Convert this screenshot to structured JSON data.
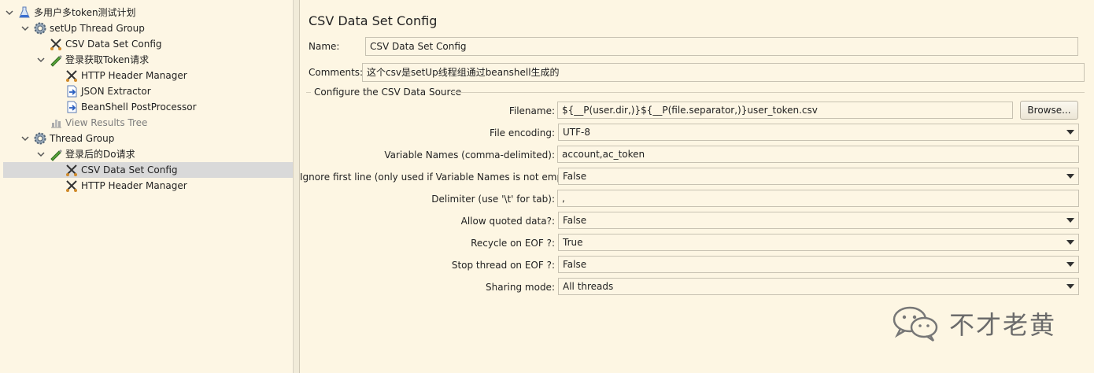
{
  "tree": {
    "items": [
      {
        "label": "多用户多token测试计划",
        "icon": "flask-icon",
        "expanded": true
      },
      {
        "label": "setUp Thread Group",
        "icon": "gear-icon",
        "expanded": true
      },
      {
        "label": "CSV Data Set Config",
        "icon": "scissors-icon"
      },
      {
        "label": "登录获取Token请求",
        "icon": "pen-icon",
        "expanded": true
      },
      {
        "label": "HTTP Header Manager",
        "icon": "scissors-icon"
      },
      {
        "label": "JSON Extractor",
        "icon": "document-arrow-icon"
      },
      {
        "label": "BeanShell PostProcessor",
        "icon": "document-arrow-icon"
      },
      {
        "label": "View Results Tree",
        "icon": "chart-icon",
        "disabled": true
      },
      {
        "label": "Thread Group",
        "icon": "gear-icon",
        "expanded": true
      },
      {
        "label": "登录后的Do请求",
        "icon": "pen-icon",
        "expanded": true
      },
      {
        "label": "CSV Data Set Config",
        "icon": "scissors-icon",
        "selected": true
      },
      {
        "label": "HTTP Header Manager",
        "icon": "scissors-icon"
      }
    ]
  },
  "panel": {
    "title": "CSV Data Set Config",
    "name_label": "Name:",
    "name_value": "CSV Data Set Config",
    "comments_label": "Comments:",
    "comments_value": "这个csv是setUp线程组通过beanshell生成的",
    "group_title": "Configure the CSV Data Source",
    "filename_label": "Filename:",
    "filename_value": "${__P(user.dir,)}${__P(file.separator,)}user_token.csv",
    "browse_label": "Browse...",
    "encoding_label": "File encoding:",
    "encoding_value": "UTF-8",
    "varnames_label": "Variable Names (comma-delimited):",
    "varnames_value": "account,ac_token",
    "ignore_label": "Ignore first line (only used if Variable Names is not empty):",
    "ignore_value": "False",
    "delimiter_label": "Delimiter (use '\\t' for tab):",
    "delimiter_value": ",",
    "quoted_label": "Allow quoted data?:",
    "quoted_value": "False",
    "recycle_label": "Recycle on EOF ?:",
    "recycle_value": "True",
    "stop_label": "Stop thread on EOF ?:",
    "stop_value": "False",
    "sharing_label": "Sharing mode:",
    "sharing_value": "All threads"
  },
  "watermark": {
    "text": "不才老黄",
    "icon": "wechat-icon"
  },
  "colors": {
    "background": "#fdf6e3",
    "selection": "#d9d9d9",
    "border": "#c8c2b2"
  }
}
